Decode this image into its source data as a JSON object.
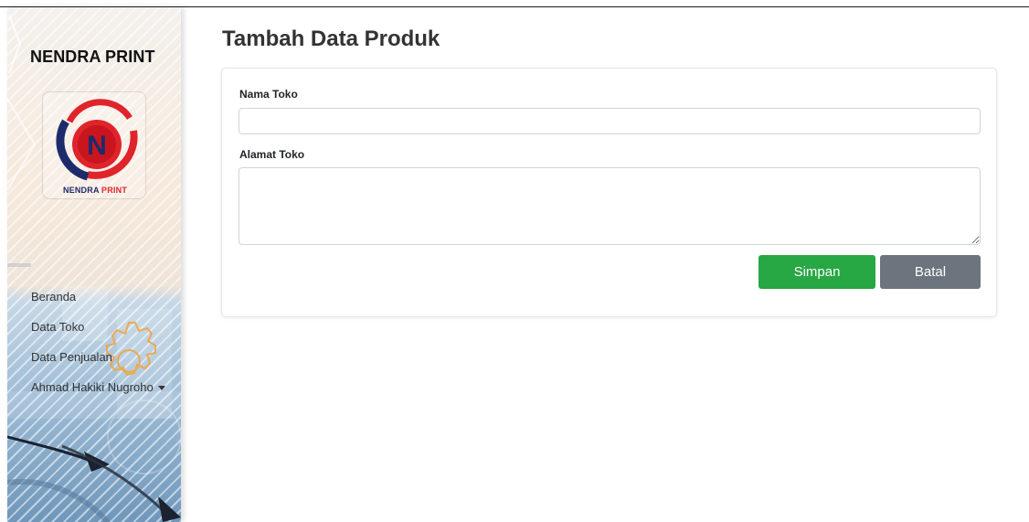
{
  "app": {
    "brand": "NENDRA PRINT",
    "logo": {
      "letter": "N",
      "caption_1": "NENDRA",
      "caption_2": "PRINT"
    }
  },
  "sidebar": {
    "items": [
      {
        "label": "Beranda"
      },
      {
        "label": "Data Toko"
      },
      {
        "label": "Data Penjualan"
      },
      {
        "label": "Ahmad Hakiki Nugroho",
        "dropdown": true
      }
    ]
  },
  "page": {
    "title": "Tambah Data Produk"
  },
  "form": {
    "store_name": {
      "label": "Nama Toko",
      "value": "",
      "placeholder": ""
    },
    "store_address": {
      "label": "Alamat Toko",
      "value": "",
      "placeholder": ""
    },
    "save_label": "Simpan",
    "cancel_label": "Batal"
  },
  "colors": {
    "save": "#28a745",
    "cancel": "#6c757d",
    "logo_red": "#e0242b",
    "logo_navy": "#1d2b6b"
  }
}
